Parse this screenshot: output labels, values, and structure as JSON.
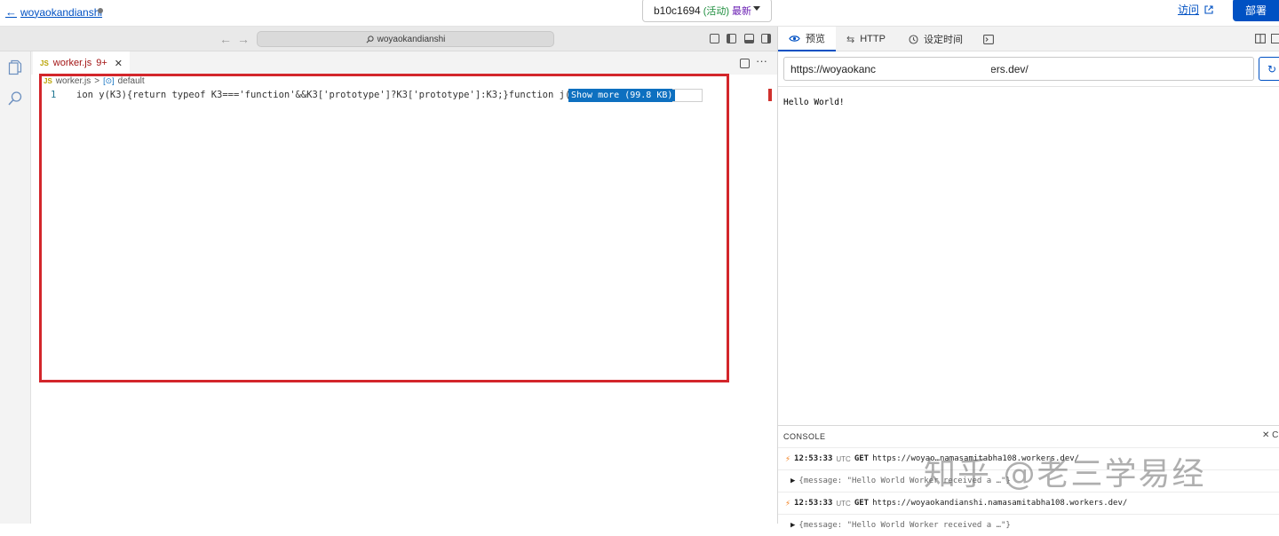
{
  "header": {
    "back_label": "woyaokandianshi",
    "version": {
      "id": "b10c1694",
      "status": "(活动)",
      "latest": "最新"
    },
    "visit_label": "访问",
    "deploy_label": "部署"
  },
  "editor": {
    "command_center": "woyaokandianshi",
    "tab": {
      "filename": "worker.js",
      "badge": "9+"
    },
    "breadcrumb": {
      "file": "worker.js",
      "symbol": "default"
    },
    "line_number": "1",
    "code": "ion y(K3){return typeof K3==='function'&&K3['prototype']?K3['prototype']:K3;}function j(K3){if(",
    "show_more": "Show more (99.8 KB)"
  },
  "preview": {
    "tabs": [
      {
        "label": "预览",
        "icon": "eye-icon"
      },
      {
        "label": "HTTP",
        "icon": "swap-arrows-icon"
      },
      {
        "label": "设定时间",
        "icon": "clock-icon"
      },
      {
        "label": "",
        "icon": "terminal-icon"
      }
    ],
    "url_prefix": "https://woyaokanc",
    "url_suffix": "rkers.dev/",
    "body_text": "Hello World!"
  },
  "console": {
    "title": "CONSOLE",
    "logs": [
      {
        "time": "12:53:33",
        "tz": "UTC",
        "method": "GET",
        "url": "https://woyao…namasamitabha108.workers.dev/"
      },
      {
        "message": "{message: \"Hello World Worker received a …\"}"
      },
      {
        "time": "12:53:33",
        "tz": "UTC",
        "method": "GET",
        "url": "https://woyaokandianshi.namasamitabha108.workers.dev/"
      },
      {
        "message": "{message: \"Hello World Worker received a …\"}"
      }
    ]
  },
  "watermark": "知乎 @老三学易经",
  "colors": {
    "accent": "#0051c3",
    "highlight_box": "#d3262b",
    "worker_orange": "#f38020"
  }
}
